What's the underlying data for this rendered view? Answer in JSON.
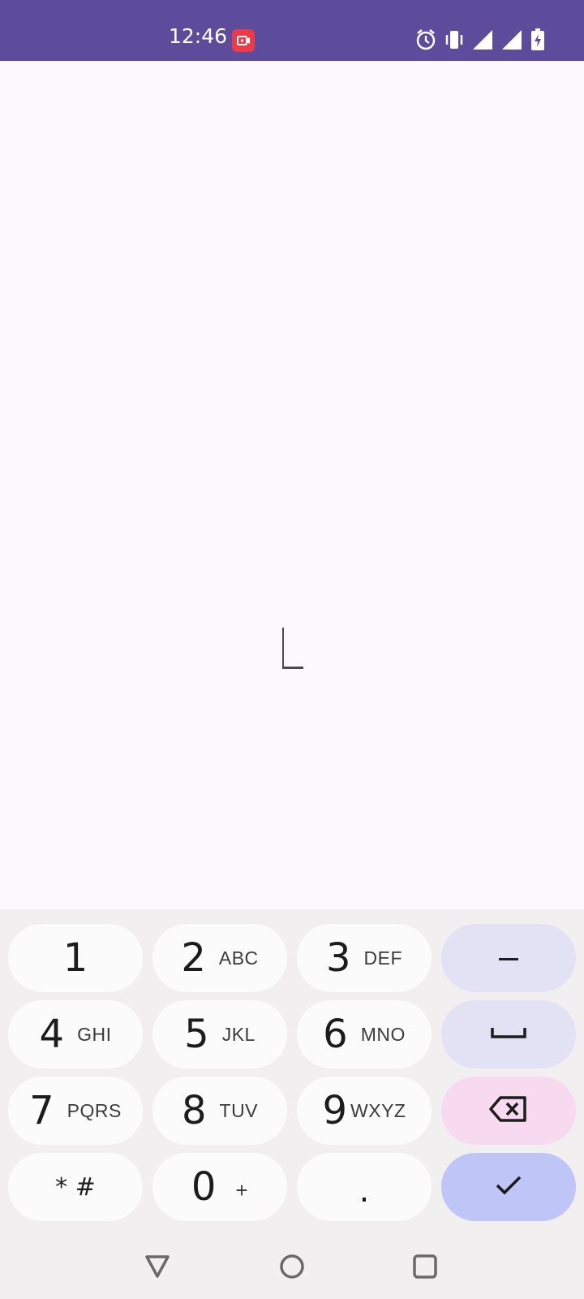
{
  "status_bar": {
    "time": "12:46",
    "icons": [
      "screen-record-icon",
      "alarm-icon",
      "vibrate-icon",
      "signal-icon",
      "signal-icon",
      "battery-charging-icon"
    ]
  },
  "colors": {
    "status_bar": "#5d4b9c",
    "background": "#fdf8fb",
    "key": "#fcfbfc",
    "accent_key": "#e3e2f5",
    "delete_key": "#f8daf0",
    "confirm_key": "#bfc6f7"
  },
  "keypad": {
    "k1": {
      "digit": "1",
      "letters": ""
    },
    "k2": {
      "digit": "2",
      "letters": "ABC"
    },
    "k3": {
      "digit": "3",
      "letters": "DEF"
    },
    "k4": {
      "digit": "4",
      "letters": "GHI"
    },
    "k5": {
      "digit": "5",
      "letters": "JKL"
    },
    "k6": {
      "digit": "6",
      "letters": "MNO"
    },
    "k7": {
      "digit": "7",
      "letters": "PQRS"
    },
    "k8": {
      "digit": "8",
      "letters": "TUV"
    },
    "k9": {
      "digit": "9",
      "letters": "WXYZ"
    },
    "star_hash": "* #",
    "k0": {
      "digit": "0",
      "letters": "+"
    },
    "dot": "."
  },
  "side_keys": [
    "minus-icon",
    "space-icon",
    "backspace-icon",
    "checkmark-icon"
  ],
  "nav_bar": [
    "back-icon",
    "home-icon",
    "recents-icon"
  ]
}
